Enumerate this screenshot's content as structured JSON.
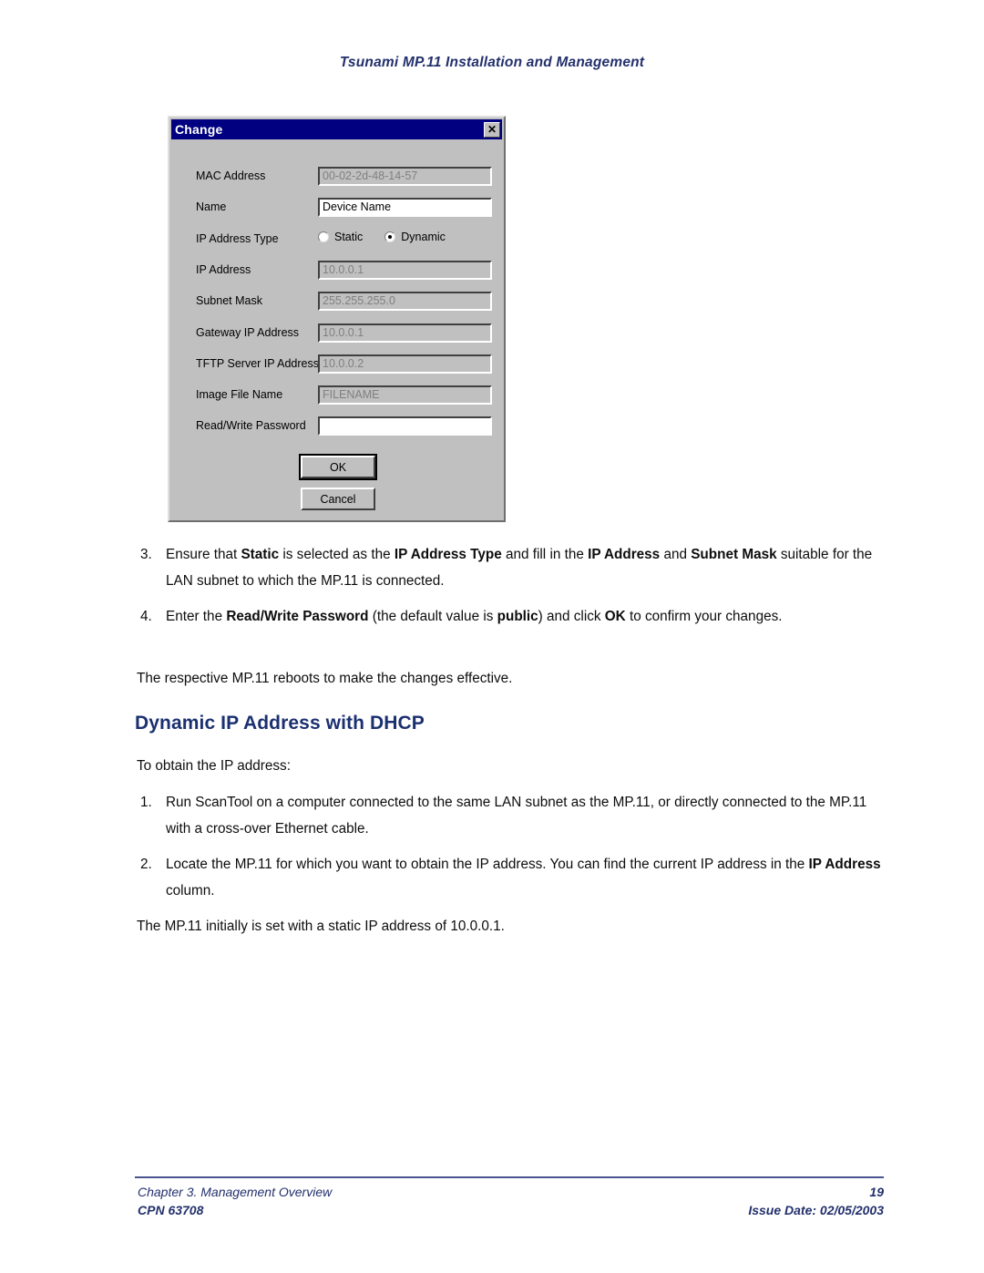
{
  "header": {
    "running_title": "Tsunami MP.11 Installation and Management"
  },
  "dialog": {
    "title": "Change",
    "close_icon": "close-x-icon",
    "fields": [
      {
        "label": "MAC Address",
        "value": "00-02-2d-48-14-57",
        "state": "disabled"
      },
      {
        "label": "Name",
        "value": "Device Name",
        "state": "enabled"
      },
      {
        "label": "IP Address",
        "value": "10.0.0.1",
        "state": "disabled"
      },
      {
        "label": "Subnet Mask",
        "value": "255.255.255.0",
        "state": "disabled"
      },
      {
        "label": "Gateway IP Address",
        "value": "10.0.0.1",
        "state": "disabled"
      },
      {
        "label": "TFTP Server IP Address",
        "value": "10.0.0.2",
        "state": "disabled"
      },
      {
        "label": "Image File Name",
        "value": "FILENAME",
        "state": "disabled"
      },
      {
        "label": "Read/Write Password",
        "value": "",
        "state": "enabled"
      }
    ],
    "ip_address_type": {
      "label": "IP Address Type",
      "options": [
        "Static",
        "Dynamic"
      ],
      "selected": "Dynamic"
    },
    "buttons": {
      "ok": "OK",
      "cancel": "Cancel"
    }
  },
  "body": {
    "step3": {
      "number": "3.",
      "text_part1": "Ensure that ",
      "bold1": "Static",
      "text_part2": " is selected as the ",
      "bold2": "IP Address Type",
      "text_part3": " and fill in the ",
      "bold3": "IP Address",
      "text_part4": " and ",
      "bold4": "Subnet Mask",
      "text_part5": " suitable for the LAN subnet to which the MP.11 is connected."
    },
    "step4": {
      "number": "4.",
      "text_part1": "Enter the ",
      "bold1": "Read/Write Password",
      "text_part2": " (the default value is ",
      "bold2": "public",
      "text_part3": ") and click ",
      "bold3": "OK",
      "text_part4": " to confirm your changes."
    },
    "reboot_note": "The respective MP.11 reboots to make the changes effective.",
    "section_heading": "Dynamic IP Address with DHCP",
    "intro": "To obtain the IP address:",
    "step1": {
      "number": "1.",
      "text": "Run ScanTool on a computer connected to the same LAN subnet as the MP.11, or directly connected to the MP.11 with a cross-over Ethernet cable."
    },
    "step2": {
      "number": "2.",
      "text_part1": "Locate the MP.11 for which you want to obtain the IP address.  You can find the current IP address in the ",
      "bold1": "IP Address",
      "text_part2": " column."
    },
    "closing_note": "The MP.11 initially is set with a static IP address of 10.0.0.1."
  },
  "footer": {
    "chapter": "Chapter 3.  Management Overview",
    "cpn": "CPN 63708",
    "page_number": "19",
    "issue_date": "Issue Date:  02/05/2003"
  },
  "colors": {
    "header_blue": "#23306c",
    "heading_navy": "#1b3070",
    "titlebar_blue": "#000080",
    "dialog_face": "#c0c0c0"
  }
}
